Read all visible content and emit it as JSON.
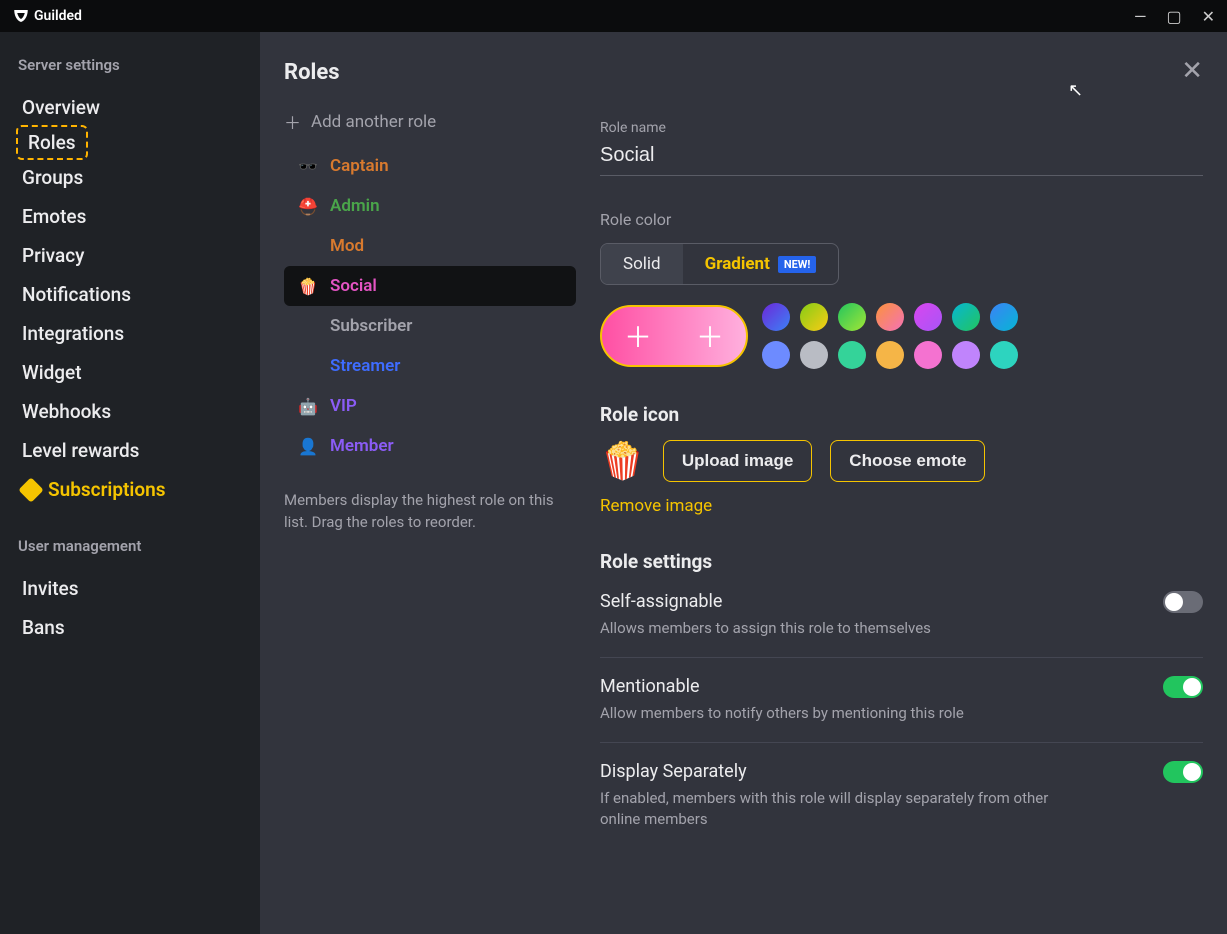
{
  "app": {
    "name": "Guilded"
  },
  "window": {
    "minimize": "—",
    "maximize": "▢",
    "close": "✕"
  },
  "sidebar": {
    "section1": "Server settings",
    "items1": [
      "Overview",
      "Roles",
      "Groups",
      "Emotes",
      "Privacy",
      "Notifications",
      "Integrations",
      "Widget",
      "Webhooks",
      "Level rewards",
      "Subscriptions"
    ],
    "section2": "User management",
    "items2": [
      "Invites",
      "Bans"
    ]
  },
  "rolesPanel": {
    "title": "Roles",
    "addRole": "Add another role",
    "roles": [
      {
        "name": "Captain",
        "color": "#d97a2e",
        "icon": "🕶️"
      },
      {
        "name": "Admin",
        "color": "#4aa54a",
        "icon": "⛑️"
      },
      {
        "name": "Mod",
        "color": "#d97a2e",
        "icon": ""
      },
      {
        "name": "Social",
        "color": "#e554c4",
        "icon": "🍿"
      },
      {
        "name": "Subscriber",
        "color": "#a3a3ac",
        "icon": ""
      },
      {
        "name": "Streamer",
        "color": "#3e6cff",
        "icon": ""
      },
      {
        "name": "VIP",
        "color": "#8b5cf6",
        "icon": "🤖"
      },
      {
        "name": "Member",
        "color": "#8b5cf6",
        "icon": "👤"
      }
    ],
    "tip": "Members display the highest role on this list. Drag the roles to reorder."
  },
  "detail": {
    "roleNameLabel": "Role name",
    "roleName": "Social",
    "roleColorLabel": "Role color",
    "solid": "Solid",
    "gradient": "Gradient",
    "newBadge": "NEW!",
    "swatches1": [
      "linear-gradient(135deg,#6d28d9,#3b82f6)",
      "linear-gradient(135deg,#84cc16,#facc15)",
      "linear-gradient(135deg,#22c55e,#a3e635)",
      "linear-gradient(135deg,#fb923c,#f472b6)",
      "linear-gradient(135deg,#d946ef,#a855f7)",
      "linear-gradient(135deg,#06b6d4,#22c55e)",
      "linear-gradient(135deg,#3b82f6,#06b6d4)"
    ],
    "swatches2": [
      "#6d8bff",
      "#b9bcc4",
      "#34d399",
      "#f5b547",
      "#f472d0",
      "#c084fc",
      "#2dd4bf"
    ],
    "roleIconLabel": "Role icon",
    "roleIconEmoji": "🍿",
    "uploadImage": "Upload image",
    "chooseEmote": "Choose emote",
    "removeImage": "Remove image",
    "roleSettingsLabel": "Role settings",
    "settings": [
      {
        "title": "Self-assignable",
        "desc": "Allows members to assign this role to themselves",
        "on": false
      },
      {
        "title": "Mentionable",
        "desc": "Allow members to notify others by mentioning this role",
        "on": true
      },
      {
        "title": "Display Separately",
        "desc": "If enabled, members with this role will display separately from other online members",
        "on": true
      }
    ]
  }
}
